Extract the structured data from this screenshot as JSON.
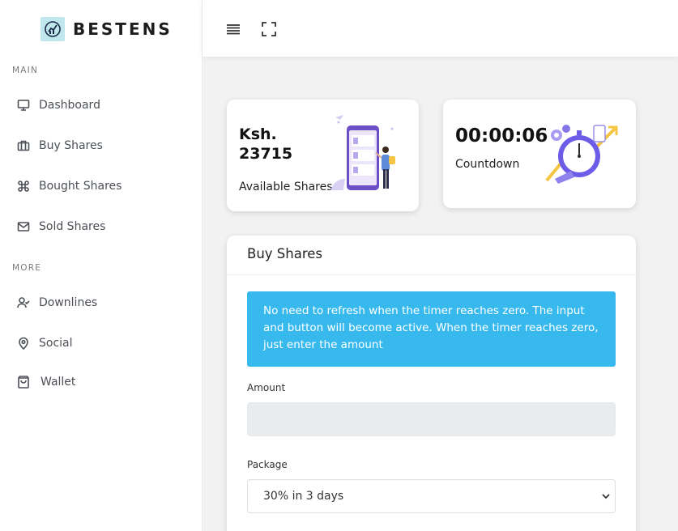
{
  "brand": {
    "name": "BESTENS",
    "logo_icon": "chart-logo-icon"
  },
  "sidebar": {
    "sections": [
      {
        "label": "MAIN"
      },
      {
        "label": "MORE"
      }
    ],
    "items": [
      {
        "label": "Dashboard",
        "icon": "monitor-icon"
      },
      {
        "label": "Buy Shares",
        "icon": "briefcase-icon"
      },
      {
        "label": "Bought Shares",
        "icon": "command-icon"
      },
      {
        "label": "Sold Shares",
        "icon": "mail-icon"
      },
      {
        "label": "Downlines",
        "icon": "user-check-icon"
      },
      {
        "label": "Social",
        "icon": "map-pin-icon"
      },
      {
        "label": "Wallet",
        "icon": "shopping-bag-icon"
      }
    ]
  },
  "topbar": {
    "menu_icon": "hamburger-icon",
    "fullscreen_icon": "fullscreen-icon"
  },
  "stats": {
    "available": {
      "currency": "Ksh.",
      "amount": "23715",
      "label": "Available Shares"
    },
    "countdown": {
      "value": "00:00:06",
      "label": "Countdown"
    }
  },
  "buy_panel": {
    "title": "Buy Shares",
    "alert": "No need to refresh when the timer reaches zero. The input and button will become active. When the timer reaches zero, just enter the amount",
    "amount_label": "Amount",
    "amount_value": "",
    "package_label": "Package",
    "package_selected": "30% in 3 days"
  },
  "colors": {
    "alert_bg": "#38b9ee",
    "accent_purple": "#6c5ce7",
    "accent_yellow": "#f5c542"
  }
}
